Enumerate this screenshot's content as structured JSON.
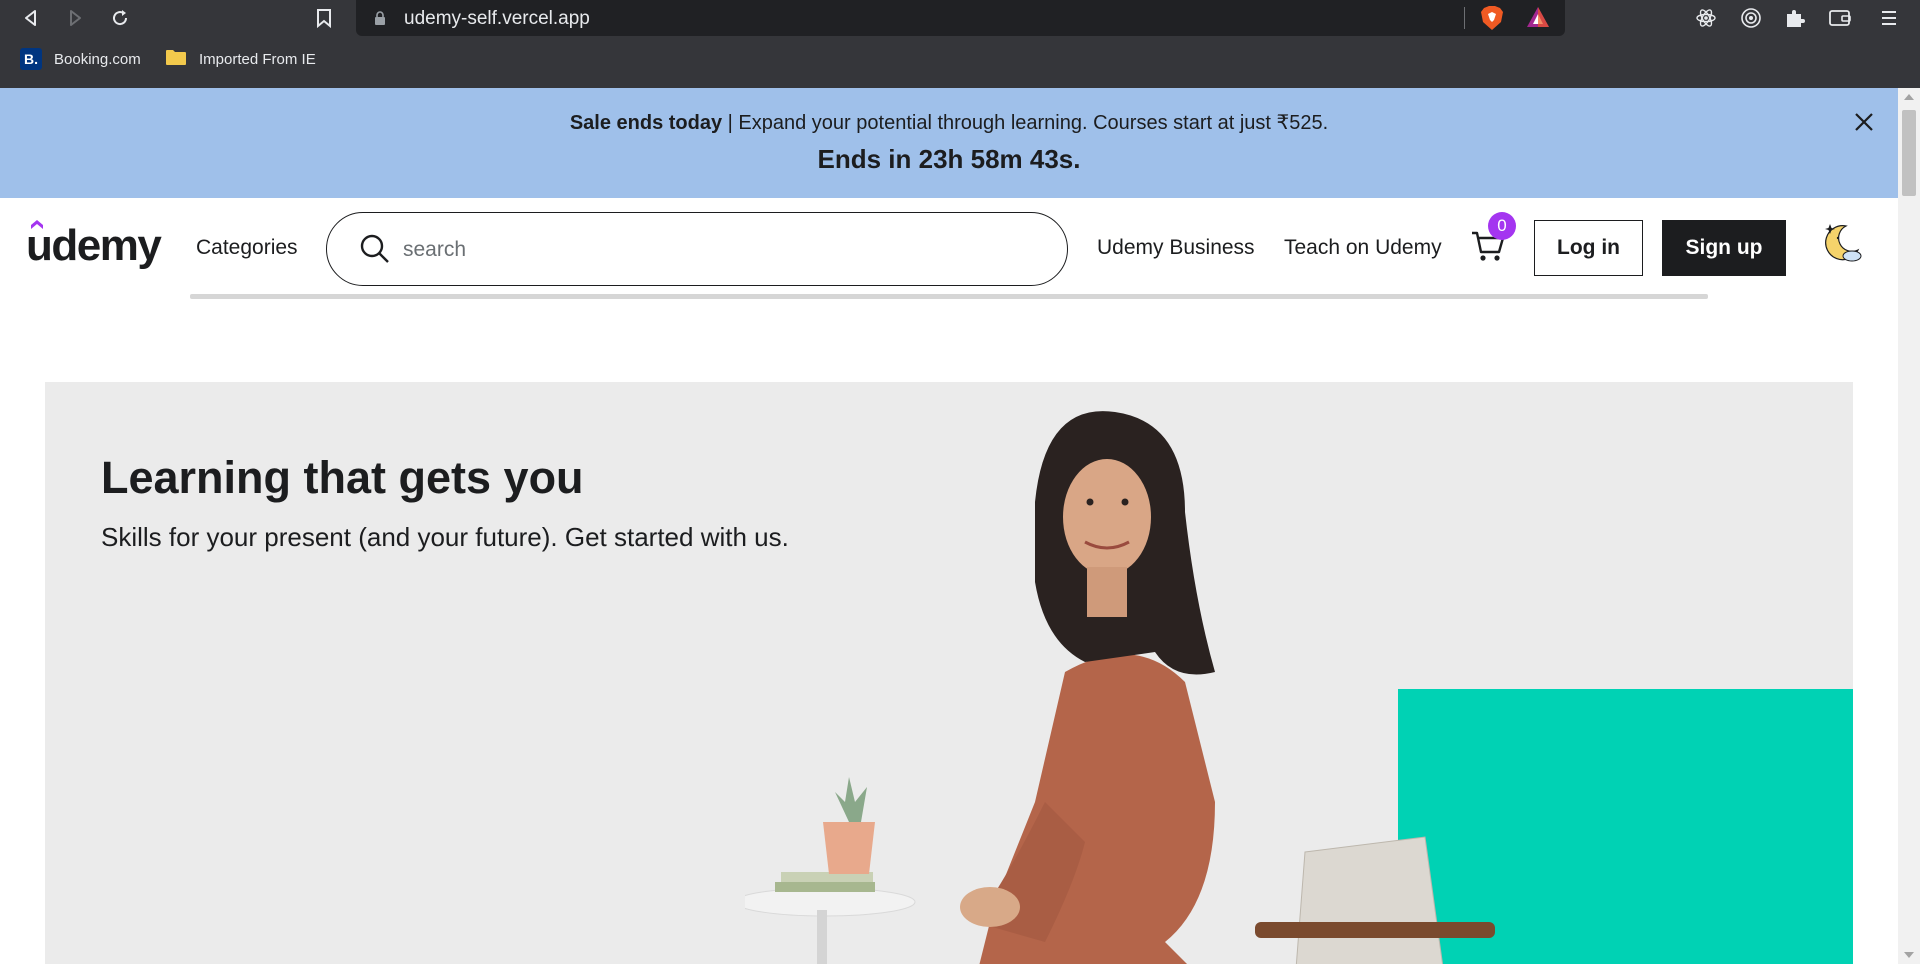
{
  "browser": {
    "url": "udemy-self.vercel.app",
    "bookmarks": [
      {
        "label": "Booking.com",
        "icon": "booking-icon"
      },
      {
        "label": "Imported From IE",
        "icon": "folder-icon"
      }
    ],
    "bookmark_b_glyph": "B."
  },
  "banner": {
    "bold": "Sale ends today",
    "text": " | Expand your potential through learning. Courses start at just ₹525.",
    "countdown": "Ends in 23h 58m 43s.",
    "bg_color": "#9fc0ea"
  },
  "header": {
    "logo": "udemy",
    "categories": "Categories",
    "search_placeholder": "search",
    "links": [
      "Udemy Business",
      "Teach on Udemy"
    ],
    "cart_count": "0",
    "login": "Log in",
    "signup": "Sign up"
  },
  "hero": {
    "title": "Learning that gets you",
    "subtitle": "Skills for your present (and your future). Get started with us.",
    "accent_color": "#00d2b4"
  },
  "colors": {
    "brand_purple": "#a435f0",
    "text_dark": "#1c1d1f"
  }
}
